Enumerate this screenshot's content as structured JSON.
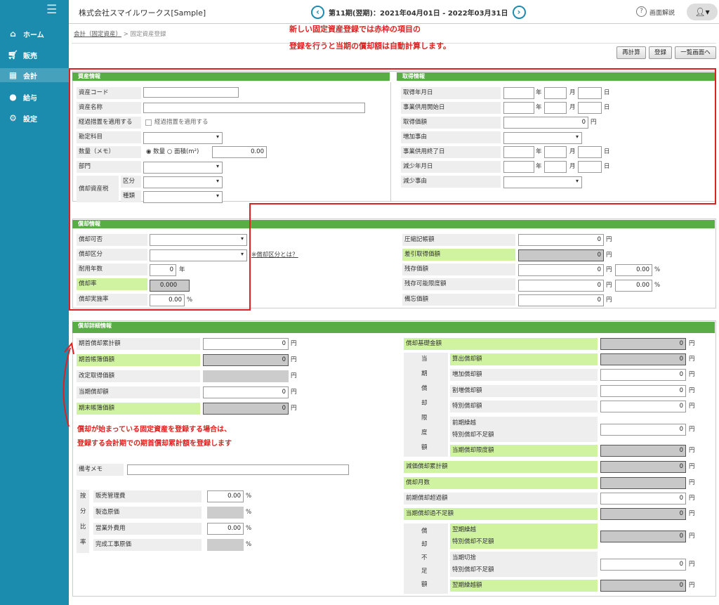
{
  "sidebar": {
    "items": [
      {
        "label": "ホーム",
        "icon": "home-icon"
      },
      {
        "label": "販売",
        "icon": "cart-icon"
      },
      {
        "label": "会計",
        "icon": "calculator-icon"
      },
      {
        "label": "給与",
        "icon": "money-bag-icon"
      },
      {
        "label": "設定",
        "icon": "gear-icon"
      }
    ]
  },
  "header": {
    "company": "株式会社スマイルワークス[Sample]",
    "period": "第11期(翌期)：2021年04月01日 - 2022年03月31日",
    "help": "画面解説"
  },
  "breadcrumb": {
    "link": "会計（固定資産）",
    "sep": ">",
    "current": "固定資産登録"
  },
  "notes": {
    "top1": "新しい固定資産登録では赤枠の項目の",
    "top2": "登録を行うと当期の償却額は自動計算します。",
    "mid1": "償却が始まっている固定資産を登録する場合は、",
    "mid2": "登録する会計期での期首償却累計額を登録します"
  },
  "toolbar": {
    "recalc": "再計算",
    "register": "登録",
    "back": "一覧画面へ"
  },
  "asset": {
    "title": "資産情報",
    "code": "資産コード",
    "name": "資産名称",
    "transition": "経過措置を適用する",
    "transition_cb": "経過措置を適用する",
    "account": "勘定科目",
    "qty": "数量（メモ）",
    "qty_opt1": "数量",
    "qty_opt2": "面積(m²)",
    "qty_val": "0.00",
    "dept": "部門",
    "deptax": "償却資産税",
    "kubun": "区分",
    "shurui": "種類"
  },
  "acq": {
    "title": "取得情報",
    "date": "取得年月日",
    "start": "事業供用開始日",
    "price": "取得価額",
    "price_val": "0",
    "yen": "円",
    "reason": "増加事由",
    "end": "事業供用終了日",
    "decdate": "減少年月日",
    "decreason": "減少事由",
    "y": "年",
    "m": "月",
    "d": "日"
  },
  "dep": {
    "title": "償却情報",
    "kahi": "償却可否",
    "kubun": "償却区分",
    "link": "※償却区分とは？",
    "years": "耐用年数",
    "years_val": "0",
    "nen": "年",
    "rate": "償却率",
    "rate_val": "0.000",
    "exec": "償却実施率",
    "exec_val": "0.00",
    "pct": "%",
    "r1": "圧縮記帳額",
    "r2": "差引取得価額",
    "r3": "残存価額",
    "r4": "残存可能限度額",
    "r5": "備忘価額",
    "zero": "0",
    "pz": "0.00"
  },
  "detail": {
    "title": "償却詳細情報",
    "l1": "期首償却累計額",
    "l2": "期首帳簿価額",
    "l3": "改定取得価額",
    "l4": "当期償却額",
    "l5": "期末帳簿価額",
    "memo": "備考メモ",
    "an_v": [
      "按",
      "分",
      "比",
      "率"
    ],
    "an1": "販売管理費",
    "an2": "製造原価",
    "an3": "営業外費用",
    "an4": "完成工事原価",
    "base": "償却基礎金額",
    "tk_v": [
      "当",
      "期",
      "償",
      "却",
      "限",
      "度",
      "額"
    ],
    "tk1": "算出償却額",
    "tk2": "増加償却額",
    "tk3": "割増償却額",
    "tk4": "特別償却額",
    "tk5a": "前期繰越",
    "tk5b": "特別償却不足額",
    "tk6": "当期償却限度額",
    "genka": "減価償却累計額",
    "months": "償却月数",
    "zenki": "前期償却超過額",
    "kafusoku": "当期償却過不足額",
    "fs_v": [
      "償",
      "却",
      "不",
      "足",
      "額"
    ],
    "fs1a": "翌期繰越",
    "fs1b": "特別償却不足額",
    "fs2a": "当期切捨",
    "fs2b": "特別償却不足額",
    "fs3": "翌期繰越額"
  }
}
